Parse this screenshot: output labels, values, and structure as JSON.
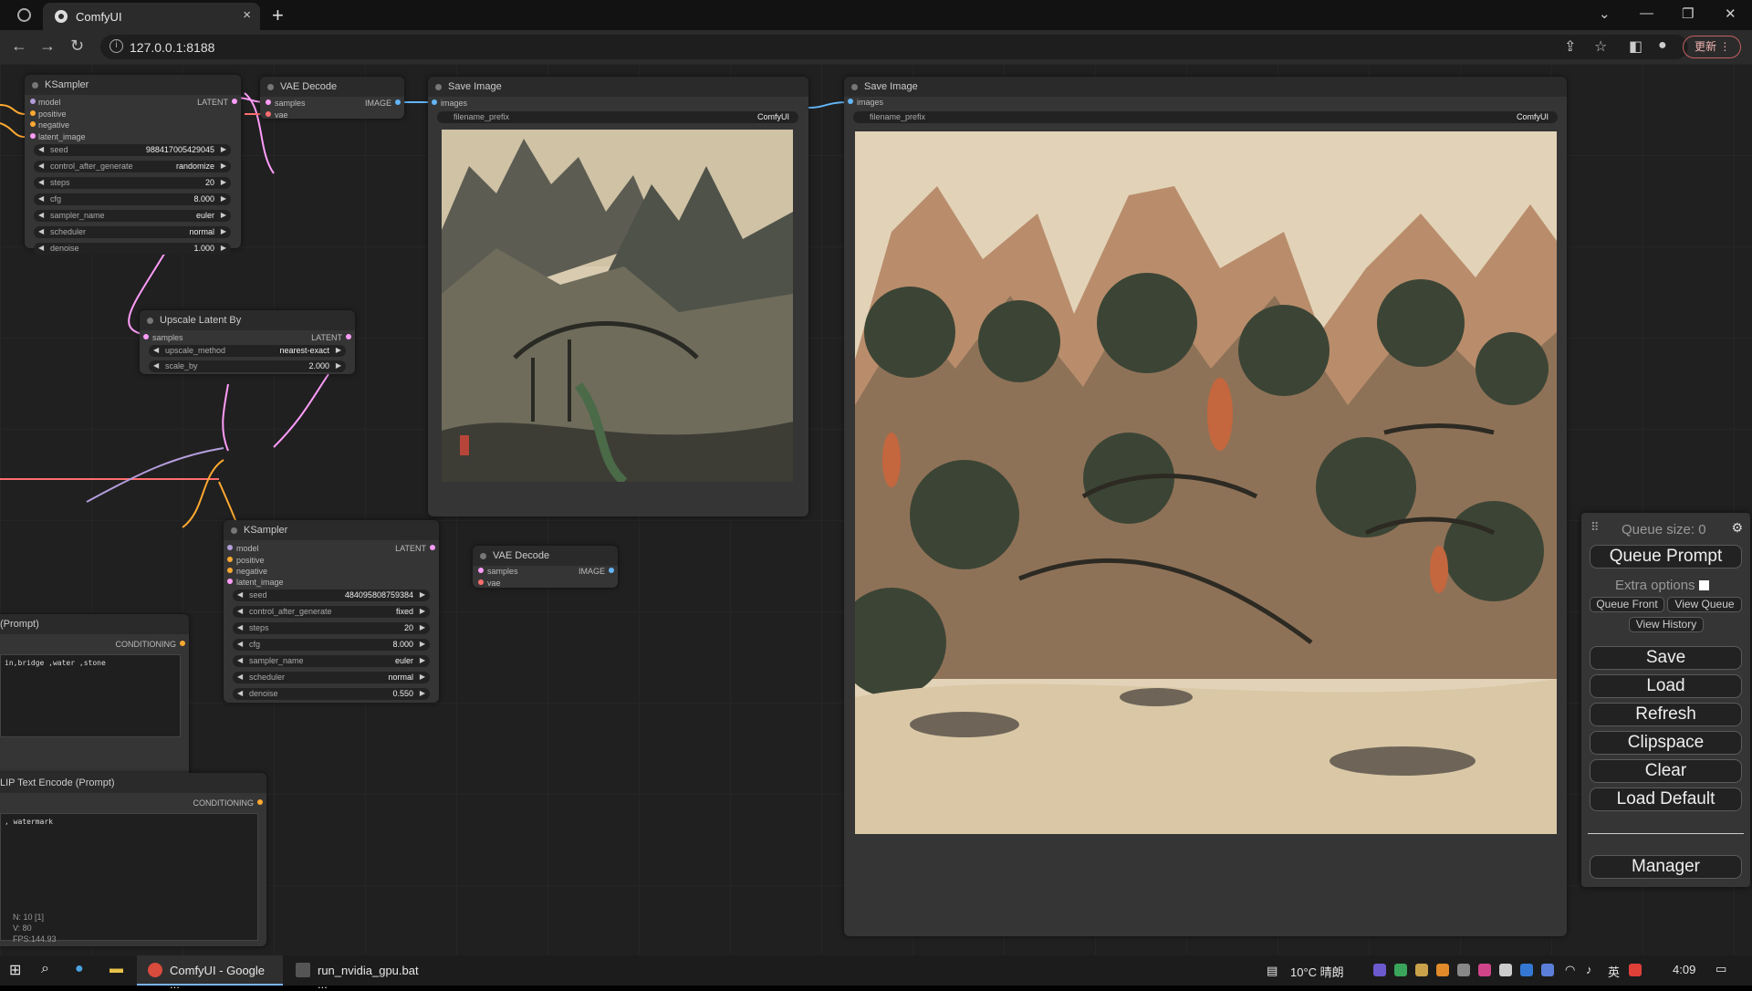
{
  "browser": {
    "tab_title": "ComfyUI",
    "url": "127.0.0.1:8188",
    "update_label": "更新",
    "minimize": "—",
    "restore": "❐",
    "close": "✕",
    "chevron": "⌄"
  },
  "nodes": {
    "ksampler1": {
      "title": "KSampler",
      "output": "LATENT",
      "inputs": [
        "model",
        "positive",
        "negative",
        "latent_image"
      ],
      "widgets": [
        {
          "label": "seed",
          "value": "988417005429045"
        },
        {
          "label": "control_after_generate",
          "value": "randomize"
        },
        {
          "label": "steps",
          "value": "20"
        },
        {
          "label": "cfg",
          "value": "8.000"
        },
        {
          "label": "sampler_name",
          "value": "euler"
        },
        {
          "label": "scheduler",
          "value": "normal"
        },
        {
          "label": "denoise",
          "value": "1.000"
        }
      ]
    },
    "vae_decode1": {
      "title": "VAE Decode",
      "inputs": [
        "samples",
        "vae"
      ],
      "output": "IMAGE"
    },
    "save_image1": {
      "title": "Save Image",
      "input": "images",
      "widget_label": "filename_prefix",
      "widget_value": "ComfyUI"
    },
    "save_image2": {
      "title": "Save Image",
      "input": "images",
      "widget_label": "filename_prefix",
      "widget_value": "ComfyUI"
    },
    "upscale": {
      "title": "Upscale Latent By",
      "input": "samples",
      "output": "LATENT",
      "widgets": [
        {
          "label": "upscale_method",
          "value": "nearest-exact"
        },
        {
          "label": "scale_by",
          "value": "2.000"
        }
      ]
    },
    "ksampler2": {
      "title": "KSampler",
      "output": "LATENT",
      "inputs": [
        "model",
        "positive",
        "negative",
        "latent_image"
      ],
      "widgets": [
        {
          "label": "seed",
          "value": "484095808759384"
        },
        {
          "label": "control_after_generate",
          "value": "fixed"
        },
        {
          "label": "steps",
          "value": "20"
        },
        {
          "label": "cfg",
          "value": "8.000"
        },
        {
          "label": "sampler_name",
          "value": "euler"
        },
        {
          "label": "scheduler",
          "value": "normal"
        },
        {
          "label": "denoise",
          "value": "0.550"
        }
      ]
    },
    "vae_decode2": {
      "title": "VAE Decode",
      "inputs": [
        "samples",
        "vae"
      ],
      "output": "IMAGE"
    },
    "clip_pos": {
      "title": "(Prompt)",
      "output": "CONDITIONING",
      "text": "in,bridge ,water ,stone"
    },
    "clip_neg": {
      "title": "LIP Text Encode (Prompt)",
      "output": "CONDITIONING",
      "text": ", watermark"
    }
  },
  "stats": {
    "line1": "N: 10 [1]",
    "line2": "V: 80",
    "line3": "FPS:144.93"
  },
  "menu": {
    "queue_size": "Queue size: 0",
    "queue_prompt": "Queue Prompt",
    "extra_options": "Extra options",
    "queue_front": "Queue Front",
    "view_queue": "View Queue",
    "view_history": "View History",
    "save": "Save",
    "load": "Load",
    "refresh": "Refresh",
    "clipspace": "Clipspace",
    "clear": "Clear",
    "load_default": "Load Default",
    "manager": "Manager"
  },
  "taskbar": {
    "app1": "ComfyUI - Google ...",
    "app2": "run_nvidia_gpu.bat ...",
    "weather": "10°C 晴朗",
    "ime": "英",
    "time": "4:09"
  },
  "colors": {
    "canvas": "#202020",
    "node": "#353535",
    "wire_latent": "#ff9cf9",
    "wire_image": "#64b5f6",
    "wire_conditioning": "#ffa931",
    "wire_vae": "#ff6e6e"
  }
}
